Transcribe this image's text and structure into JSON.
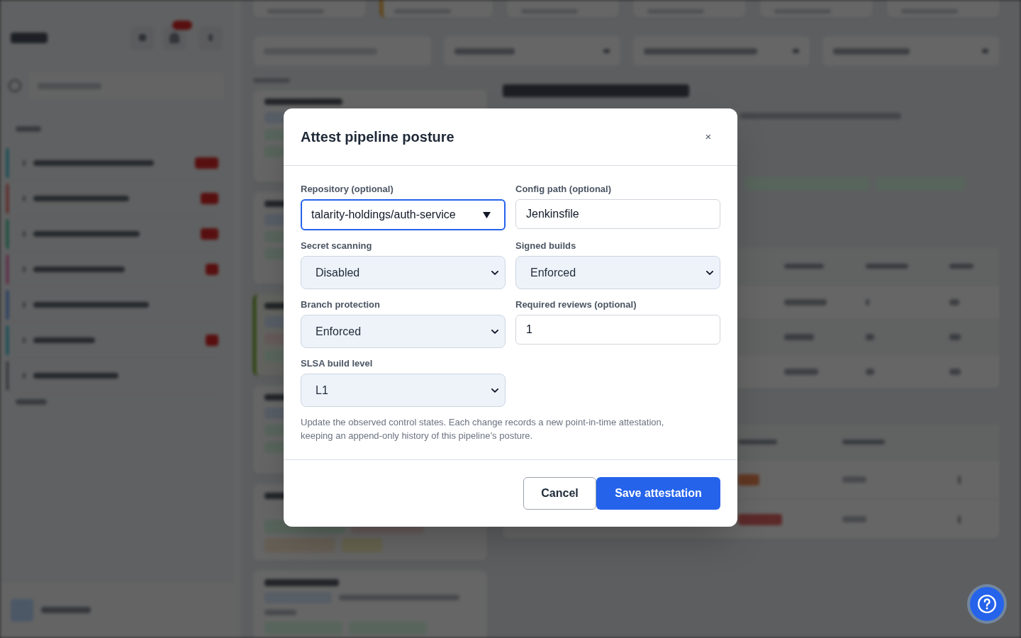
{
  "modal": {
    "title": "Attest pipeline posture",
    "close": "×",
    "fields": [
      {
        "label": "Repository (optional)",
        "kind": "combo",
        "value": "talarity-holdings/auth-service",
        "focused": true
      },
      {
        "label": "Config path (optional)",
        "kind": "text",
        "value": "Jenkinsfile",
        "focused": false
      },
      {
        "label": "Secret scanning",
        "kind": "select",
        "value": "Disabled",
        "focused": false
      },
      {
        "label": "Signed builds",
        "kind": "select",
        "value": "Enforced",
        "focused": false
      },
      {
        "label": "Branch protection",
        "kind": "select",
        "value": "Enforced",
        "focused": false
      },
      {
        "label": "Required reviews (optional)",
        "kind": "text",
        "value": "1",
        "focused": false
      },
      {
        "label": "SLSA build level",
        "kind": "select",
        "value": "L1",
        "focused": false
      }
    ],
    "help": "Update the observed control states. Each change records a new point-in-time attestation, keeping an append-only history of this pipeline’s posture.",
    "buttons": [
      {
        "label": "Cancel",
        "kind": "secondary"
      },
      {
        "label": "Save attestation",
        "kind": "primary"
      }
    ]
  }
}
